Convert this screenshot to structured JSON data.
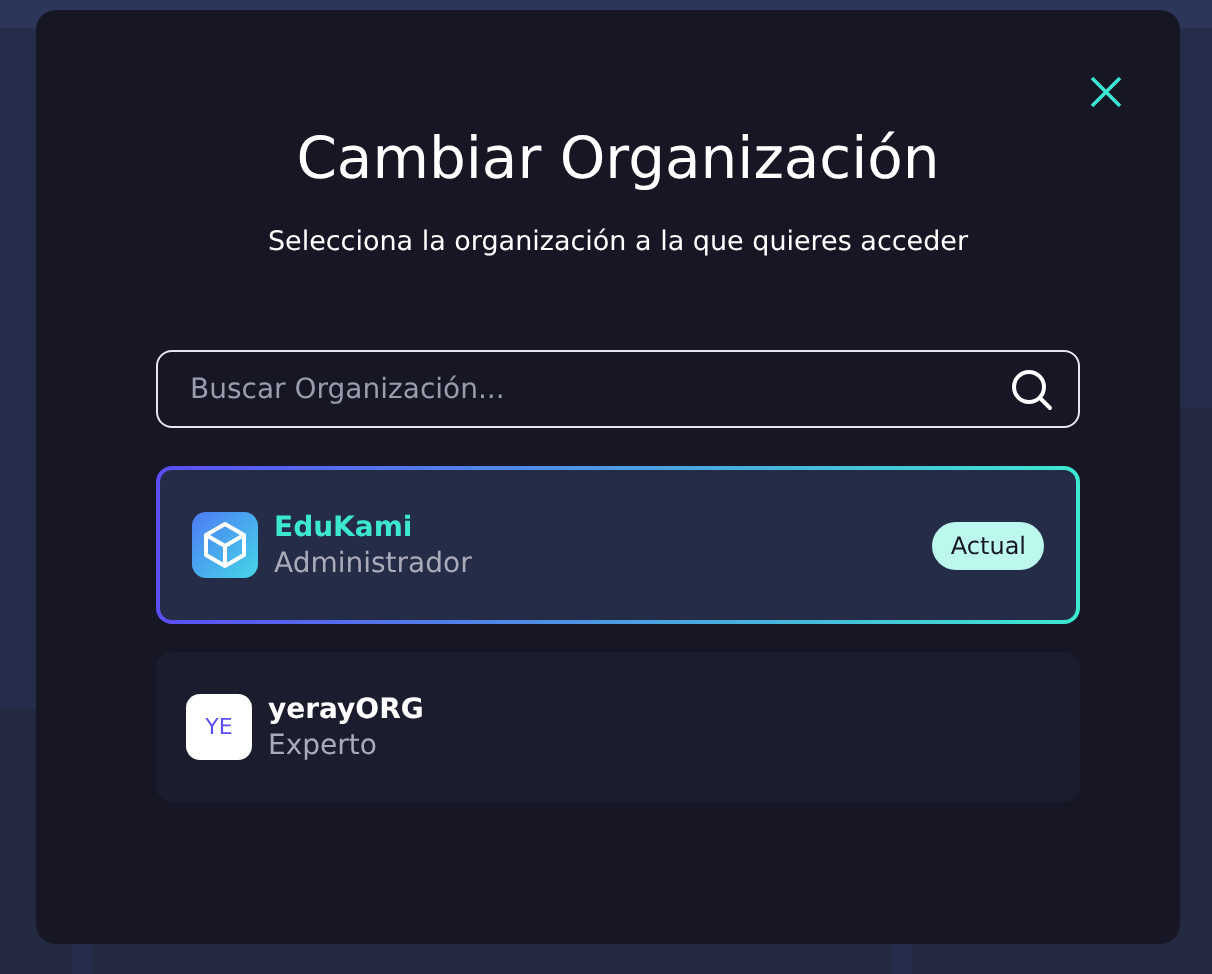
{
  "dialog": {
    "title": "Cambiar Organización",
    "subtitle": "Selecciona la organización a la que quieres acceder"
  },
  "search": {
    "placeholder": "Buscar Organización..."
  },
  "organizations": [
    {
      "name": "EduKami",
      "role": "Administrador",
      "selected": true,
      "badge": "Actual",
      "kind": "cube"
    },
    {
      "name": "yerayORG",
      "role": "Experto",
      "selected": false,
      "initials": "YE",
      "kind": "initials"
    }
  ]
}
